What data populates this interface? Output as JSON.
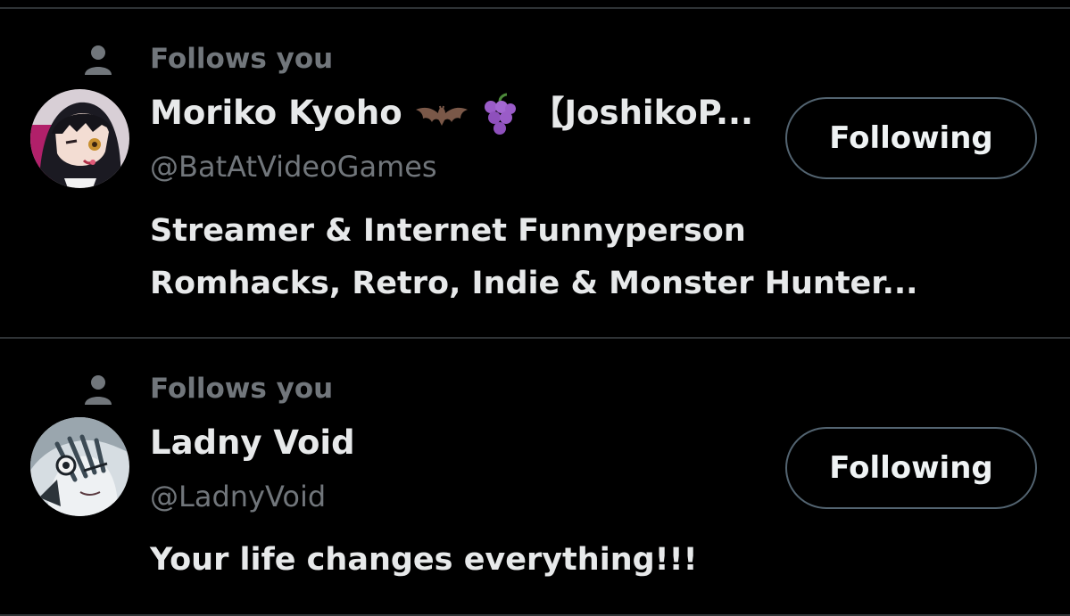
{
  "users": [
    {
      "follows_label": "Follows you",
      "display_name": "Moriko Kyoho",
      "name_suffix": "【JoshikoP...",
      "emojis": [
        "bat-emoji",
        "grapes-emoji"
      ],
      "handle": "@BatAtVideoGames",
      "bio_lines": [
        "Streamer & Internet Funnyperson",
        "Romhacks, Retro, Indie & Monster Hunter..."
      ],
      "button_label": "Following"
    },
    {
      "follows_label": "Follows you",
      "display_name": "Ladny Void",
      "handle": "@LadnyVoid",
      "bio_lines": [
        "Your life changes everything!!!"
      ],
      "button_label": "Following"
    }
  ],
  "colors": {
    "background": "#000000",
    "primary_text": "#e7e9ea",
    "secondary_text": "#71767b",
    "divider": "#2f3336",
    "button_border": "#536471"
  }
}
